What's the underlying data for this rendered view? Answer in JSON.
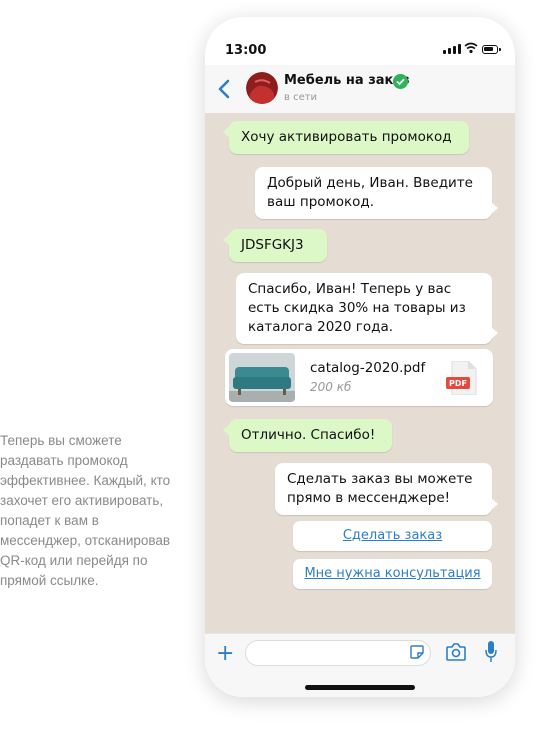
{
  "side_text": "Теперь вы сможете раздавать промокод эффективнее. Каждый, кто захочет его активировать, попадет к вам в мессенджер, отсканировав QR-код или перейдя по прямой ссылке.",
  "status_bar": {
    "time": "13:00"
  },
  "header": {
    "name": "Мебель на заказ",
    "status": "в сети"
  },
  "messages": [
    {
      "side": "out",
      "text": "Хочу активировать промокод"
    },
    {
      "side": "in",
      "text": "Добрый день, Иван. Введите ваш промокод."
    },
    {
      "side": "out",
      "text": "JDSFGKJ3"
    },
    {
      "side": "in",
      "text": "Спасибо, Иван! Теперь у вас есть скидка 30% на товары из каталога 2020 года."
    },
    {
      "side": "out",
      "text": "Отлично. Спасибо!"
    },
    {
      "side": "in",
      "text": "Сделать заказ вы можете прямо в мессенджере!"
    }
  ],
  "file": {
    "name": "catalog-2020.pdf",
    "size": "200 кб",
    "badge": "PDF"
  },
  "actions": {
    "order": "Сделать заказ",
    "consult": "Мне нужна консультация"
  },
  "colors": {
    "outgoing": "#dcf8c6",
    "incoming": "#ffffff",
    "chat_bg": "#e5ddd4",
    "link": "#2d7ec6",
    "verified": "#2fb35a",
    "pdf": "#e5483c"
  },
  "icons": [
    "back-icon",
    "verified-icon",
    "plus-icon",
    "sticker-icon",
    "camera-icon",
    "mic-icon",
    "pdf-icon",
    "wifi-icon",
    "battery-icon",
    "signal-icon"
  ]
}
